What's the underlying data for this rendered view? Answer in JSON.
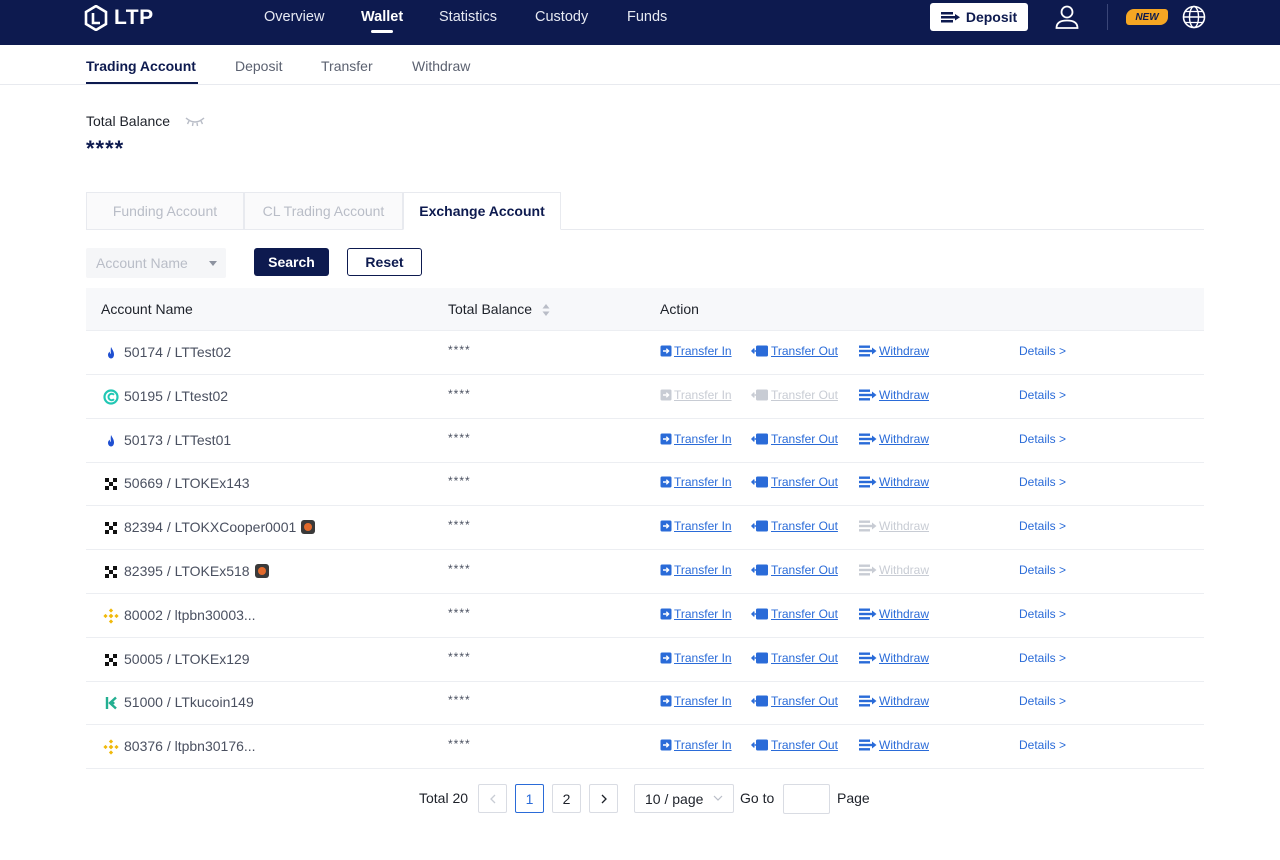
{
  "brand": {
    "name": "LTP"
  },
  "nav": {
    "items": [
      {
        "label": "Overview"
      },
      {
        "label": "Wallet"
      },
      {
        "label": "Statistics"
      },
      {
        "label": "Custody"
      },
      {
        "label": "Funds"
      }
    ],
    "active": "Wallet",
    "deposit_label": "Deposit",
    "new_badge": "NEW"
  },
  "subtabs": [
    {
      "label": "Trading Account"
    },
    {
      "label": "Deposit"
    },
    {
      "label": "Transfer"
    },
    {
      "label": "Withdraw"
    }
  ],
  "balance": {
    "label": "Total Balance",
    "value": "****"
  },
  "account_tabs": [
    {
      "label": "Funding Account"
    },
    {
      "label": "CL Trading Account"
    },
    {
      "label": "Exchange Account"
    }
  ],
  "filters": {
    "account_name_placeholder": "Account Name",
    "search_label": "Search",
    "reset_label": "Reset"
  },
  "table": {
    "headers": {
      "account_name": "Account Name",
      "total_balance": "Total Balance",
      "action": "Action"
    },
    "action_labels": {
      "transfer_in": "Transfer In",
      "transfer_out": "Transfer Out",
      "withdraw": "Withdraw",
      "details": "Details >"
    },
    "rows": [
      {
        "account": "50174 / LTTest02",
        "exchange_icon": "flame-icon",
        "balance": "****",
        "transfer_enabled": true,
        "withdraw_enabled": true,
        "tag": false
      },
      {
        "account": "50195 / LTtest02",
        "exchange_icon": "circle-c-icon",
        "balance": "****",
        "transfer_enabled": false,
        "withdraw_enabled": true,
        "tag": false
      },
      {
        "account": "50173 / LTTest01",
        "exchange_icon": "flame-icon",
        "balance": "****",
        "transfer_enabled": true,
        "withdraw_enabled": true,
        "tag": false
      },
      {
        "account": "50669 / LTOKEx143",
        "exchange_icon": "okx-icon",
        "balance": "****",
        "transfer_enabled": true,
        "withdraw_enabled": true,
        "tag": false
      },
      {
        "account": "82394 / LTOKXCooper0001",
        "exchange_icon": "okx-icon",
        "balance": "****",
        "transfer_enabled": true,
        "withdraw_enabled": false,
        "tag": true
      },
      {
        "account": "82395 / LTOKEx518",
        "exchange_icon": "okx-icon",
        "balance": "****",
        "transfer_enabled": true,
        "withdraw_enabled": false,
        "tag": true
      },
      {
        "account": "80002 / ltpbn30003...",
        "exchange_icon": "binance-icon",
        "balance": "****",
        "transfer_enabled": true,
        "withdraw_enabled": true,
        "tag": false
      },
      {
        "account": "50005 / LTOKEx129",
        "exchange_icon": "okx-icon",
        "balance": "****",
        "transfer_enabled": true,
        "withdraw_enabled": true,
        "tag": false
      },
      {
        "account": "51000 / LTkucoin149",
        "exchange_icon": "kucoin-icon",
        "balance": "****",
        "transfer_enabled": true,
        "withdraw_enabled": true,
        "tag": false
      },
      {
        "account": "80376 / ltpbn30176...",
        "exchange_icon": "binance-icon",
        "balance": "****",
        "transfer_enabled": true,
        "withdraw_enabled": true,
        "tag": false
      }
    ]
  },
  "pagination": {
    "total_text": "Total 20",
    "pages": [
      "1",
      "2"
    ],
    "current": "1",
    "page_size": "10 / page",
    "goto_label": "Go to",
    "page_label": "Page"
  },
  "colors": {
    "navy": "#0d1a4f",
    "link": "#2a6bd8",
    "disabled": "#c8ccd4",
    "badge": "#f5a623"
  }
}
